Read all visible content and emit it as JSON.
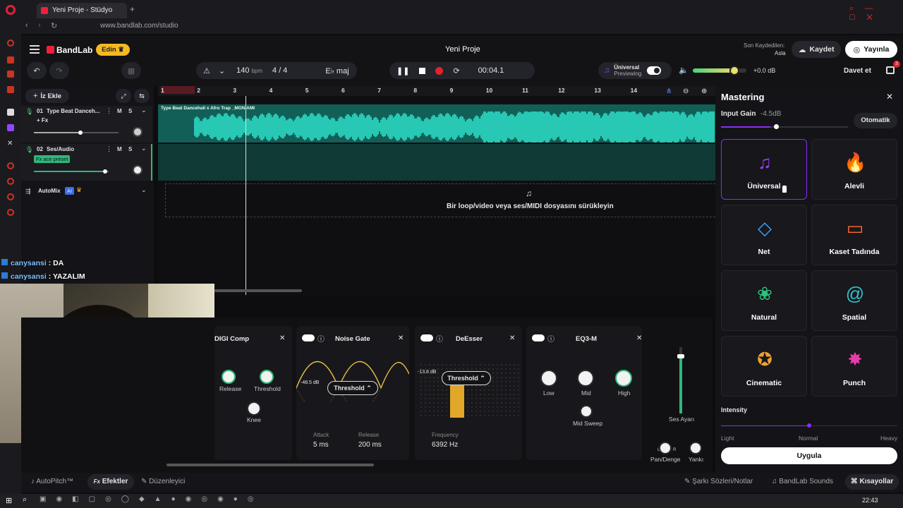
{
  "browser": {
    "tab_title": "Yeni Proje - Stüdyo",
    "url": "www.bandlab.com/studio"
  },
  "header": {
    "brand": "BandLab",
    "edit_badge": "Edin",
    "project_title": "Yeni Proje",
    "last_saved_label": "Son Kaydedilen:",
    "last_saved_value": "Asla",
    "save_label": "Kaydet",
    "publish_label": "Yayınla",
    "invite_label": "Davet et",
    "cart_badge": "3",
    "bpm_value": "140",
    "bpm_unit": "bpm",
    "time_signature": "4 / 4",
    "key": "E♭ maj",
    "time": "00:04.1",
    "master_preset_name": "Üniversal",
    "master_preset_state": "Previewing",
    "volume_db": "+0.0 dB",
    "volume_level": 0.78
  },
  "tracks": {
    "add_label": "İz Ekle",
    "items": [
      {
        "number": "01",
        "name": "Type Beat Danceh...",
        "fx": "+ Fx",
        "m": "M",
        "s": "S",
        "volume": 0.55
      },
      {
        "number": "02",
        "name": "Ses/Audio",
        "fx": "Fx ace preset",
        "m": "M",
        "s": "S",
        "volume": 0.95
      }
    ],
    "automix_label": "AutoMix",
    "automix_badge": "AI"
  },
  "timeline": {
    "ruler": [
      "1",
      "2",
      "3",
      "4",
      "5",
      "6",
      "7",
      "8",
      "9",
      "10",
      "11",
      "12",
      "13",
      "14"
    ],
    "clip_title": "Type Beat Dancehall x Afro Trap _MON AMI",
    "drop_hint": "Bir loop/video veya ses/MIDI dosyasını sürükleyin"
  },
  "chat": [
    {
      "user": "canysansi",
      "msg": "DA"
    },
    {
      "user": "canysansi",
      "msg": "YAZALIM"
    }
  ],
  "effects": {
    "digi_comp": {
      "title": "DIGI Comp",
      "knobs": [
        "Release",
        "Threshold",
        "Knee"
      ]
    },
    "noise_gate": {
      "title": "Noise Gate",
      "threshold_label": "Threshold",
      "db": "-48.5 dB",
      "attack_label": "Attack",
      "attack_value": "5 ms",
      "release_label": "Release",
      "release_value": "200 ms"
    },
    "deesser": {
      "title": "DeEsser",
      "threshold_label": "Threshold",
      "db": "-13.8 dB",
      "freq_label": "Frequency",
      "freq_value": "6392 Hz"
    },
    "eq3": {
      "title": "EQ3-M",
      "knobs": [
        "Low",
        "Mid",
        "High"
      ],
      "sweep": "Mid Sweep"
    },
    "ses_ayari": "Ses Ayarı",
    "pan_label": "Pan/Denge",
    "reverb_label": "Yankı",
    "pan_l": "L",
    "pan_r": "R"
  },
  "mastering": {
    "title": "Mastering",
    "input_gain_label": "Input Gain",
    "input_gain_value": "-4.5dB",
    "auto_label": "Otomatik",
    "presets": [
      {
        "name": "Üniversal",
        "icon": "music-notes-icon",
        "color": "#9b3ff5"
      },
      {
        "name": "Alevli",
        "icon": "flame-icon",
        "color": "#e8442c"
      },
      {
        "name": "Net",
        "icon": "diamond-icon",
        "color": "#3aa4ff"
      },
      {
        "name": "Kaset Tadında",
        "icon": "cassette-icon",
        "color": "#ff6a2a"
      },
      {
        "name": "Natural",
        "icon": "lotus-icon",
        "color": "#2ec27e"
      },
      {
        "name": "Spatial",
        "icon": "spiral-icon",
        "color": "#2ec2c9"
      },
      {
        "name": "Cinematic",
        "icon": "film-reel-icon",
        "color": "#f0a030"
      },
      {
        "name": "Punch",
        "icon": "burst-icon",
        "color": "#e83ca8"
      }
    ],
    "intensity_label": "Intensity",
    "intensity_levels": [
      "Light",
      "Normal",
      "Heavy"
    ],
    "intensity_value": "Normal",
    "apply_label": "Uygula"
  },
  "bottom": {
    "autopitch": "AutoPitch™",
    "effects": "Efektler",
    "editor": "Düzenleyici",
    "lyrics": "Şarkı Sözleri/Notlar",
    "sounds": "BandLab Sounds",
    "shortcuts": "Kısayollar"
  },
  "taskbar": {
    "time": "22:43"
  }
}
